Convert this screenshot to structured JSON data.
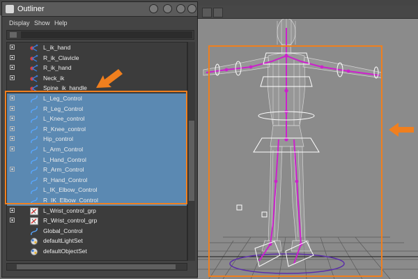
{
  "window": {
    "title": "Outliner"
  },
  "menu": [
    "Display",
    "Show",
    "Help"
  ],
  "outliner_rows": [
    {
      "label": "L_ik_hand",
      "icon": "ik-handle-icon",
      "expandable": true,
      "selected": false
    },
    {
      "label": "R_ik_Clavicle",
      "icon": "ik-handle-icon",
      "expandable": true,
      "selected": false
    },
    {
      "label": "R_ik_hand",
      "icon": "ik-handle-icon",
      "expandable": true,
      "selected": false
    },
    {
      "label": "Neck_ik",
      "icon": "ik-handle-icon",
      "expandable": true,
      "selected": false
    },
    {
      "label": "Spine_ik_handle",
      "icon": "ik-handle-icon",
      "expandable": false,
      "selected": false
    },
    {
      "label": "L_Leg_Control",
      "icon": "nurbs-curve-icon",
      "expandable": true,
      "selected": true
    },
    {
      "label": "R_Leg_Control",
      "icon": "nurbs-curve-icon",
      "expandable": true,
      "selected": true
    },
    {
      "label": "L_Knee_control",
      "icon": "nurbs-curve-icon",
      "expandable": true,
      "selected": true
    },
    {
      "label": "R_Knee_control",
      "icon": "nurbs-curve-icon",
      "expandable": true,
      "selected": true
    },
    {
      "label": "Hip_control",
      "icon": "nurbs-curve-icon",
      "expandable": true,
      "selected": true
    },
    {
      "label": "L_Arm_Control",
      "icon": "nurbs-curve-icon",
      "expandable": true,
      "selected": true
    },
    {
      "label": "L_Hand_Control",
      "icon": "nurbs-curve-icon",
      "expandable": false,
      "selected": true
    },
    {
      "label": "R_Arm_Control",
      "icon": "nurbs-curve-icon",
      "expandable": true,
      "selected": true
    },
    {
      "label": "R_Hand_Control",
      "icon": "nurbs-curve-icon",
      "expandable": false,
      "selected": true
    },
    {
      "label": "L_IK_Elbow_Control",
      "icon": "nurbs-curve-icon",
      "expandable": false,
      "selected": true
    },
    {
      "label": "R_IK_Elbow_Control",
      "icon": "nurbs-curve-icon",
      "expandable": false,
      "selected": true
    },
    {
      "label": "L_Wrist_control_grp",
      "icon": "group-icon",
      "expandable": true,
      "selected": false
    },
    {
      "label": "R_Wrist_control_grp",
      "icon": "group-icon",
      "expandable": true,
      "selected": false
    },
    {
      "label": "Global_Control",
      "icon": "nurbs-curve-icon",
      "expandable": false,
      "selected": false
    },
    {
      "label": "defaultLightSet",
      "icon": "set-icon",
      "expandable": false,
      "selected": false
    },
    {
      "label": "defaultObjectSet",
      "icon": "set-icon",
      "expandable": false,
      "selected": false
    }
  ],
  "colors": {
    "selection": "#5b89b2",
    "highlight_border": "#f07f1e",
    "rig_magenta": "#cc22cc",
    "wireframe": "#dcdcdc",
    "ground_grid": "#5a5a5a"
  }
}
